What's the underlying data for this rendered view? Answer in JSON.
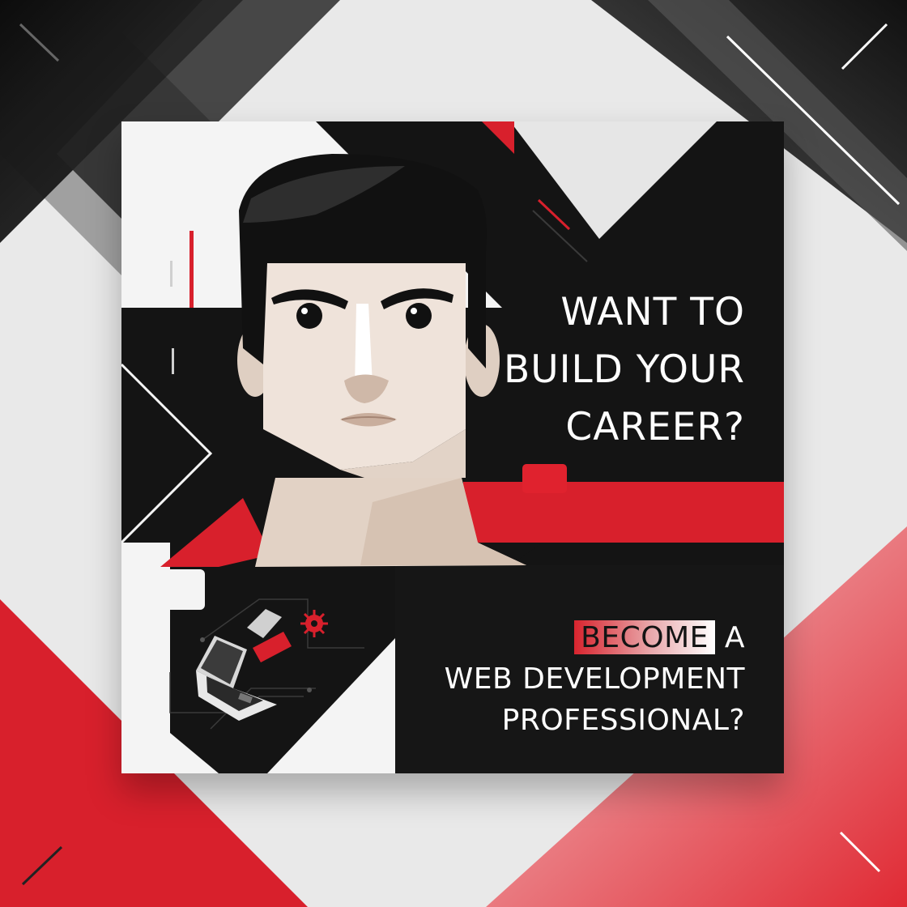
{
  "poster": {
    "headline_lines": [
      "WANT TO",
      "BUILD YOUR",
      "CAREER?"
    ],
    "tagline": {
      "highlight": "BECOME",
      "after_highlight": "A",
      "line2": "WEB DEVELOPMENT",
      "line3": "PROFESSIONAL?"
    }
  },
  "colors": {
    "accent_red": "#d8202c",
    "black": "#141414",
    "skin": "#efe3da",
    "background_gray": "#e9e9e9"
  },
  "icons": [
    "laptop-icon",
    "virus-icon",
    "person-illustration"
  ]
}
